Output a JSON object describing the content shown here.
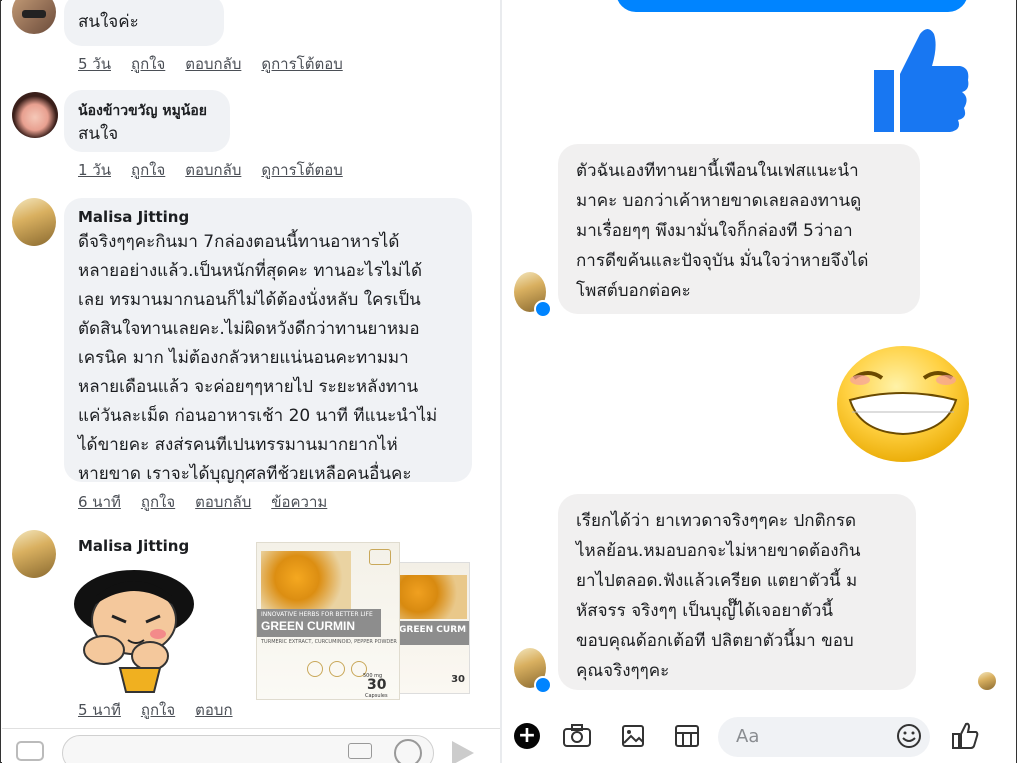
{
  "comments": [
    {
      "name": "",
      "text": "สนใจค่ะ",
      "time": "5 วัน",
      "like": "ถูกใจ",
      "reply": "ตอบกลับ",
      "more": "ดูการโต้ตอบ"
    },
    {
      "name": "น้องข้าวขวัญ หมูน้อย",
      "text": "สนใจ",
      "time": "1 วัน",
      "like": "ถูกใจ",
      "reply": "ตอบกลับ",
      "more": "ดูการโต้ตอบ"
    },
    {
      "name": "Malisa Jitting",
      "lines": [
        "ดีจริงๆๆคะกินมา 7กล่องตอนนี้ทานอาหารได้",
        "หลายอย่างแล้ว.เป็นหนักที่สุดคะ ทานอะไรไม่ได้",
        "เลย ทรมานมากนอนก็ไม่ได้ต้องนั่งหลับ ใครเป็น",
        "ตัดสินใจทานเลยคะ.ไม่ผิดหวังดีกว่าทานยาหมอ",
        "เครนิค มาก ไม่ต้องกลัวหายแน่นอนคะทามมา",
        "หลายเดือนแล้ว จะค่อยๆๆหายไป ระยะหลังทาน",
        "แค่วันละเม็ด ก่อนอาหารเช้า 20 นาที ทีแนะนำไม่",
        "ได้ขายคะ สงส่รคนทีเปนทรรมานมากยากไห่",
        "หายขาด เราจะได้บุญกุศลทีช้วยเหลือคนอื่นคะ"
      ],
      "time": "6 นาที",
      "like": "ถูกใจ",
      "reply": "ตอบกลับ",
      "more": "ข้อความ"
    },
    {
      "name": "Malisa Jitting",
      "time": "5 นาที",
      "like": "ถูกใจ",
      "reply": "ตอบก"
    }
  ],
  "product": {
    "tagline": "INNOVATIVE HERBS FOR BETTER LIFE",
    "brand": "GREEN CURMIN",
    "sub": "TURMERIC EXTRACT, CURCUMINOID, PEPPER POWDER",
    "count": "30",
    "count_unit": "Capsules",
    "dose": "500 mg"
  },
  "messages": [
    {
      "lines": [
        "ตัวฉันเองทีทานยานี้เพือนในเฟสแนะนำ",
        "มาคะ บอกว่าเค้าหายขาดเลยลองทานดู",
        "มาเรื่อยๆๆ พึงมามั่นใจก็กล่องที 5ว่าอา",
        "การดีขค้นและปัจจุบัน มั่นใจว่าหายจึงได่",
        "โพสต์บอกต่อคะ"
      ]
    },
    {
      "lines": [
        "เรียกได้ว่า ยาเทวดาจริงๆๆคะ ปกติกรด",
        "ไหลย้อน.หมอบอกจะไม่หายขาดต้องกิน",
        "ยาไปตลอด.ฟังแล้วเครียด แตยาตัวนี้ ม",
        "หัสจรร จริงๆๆ เป็นบุญ๊๊ได้เจอยาตัวนี้",
        "ขอบคุณด้อกเต้อที ปลิตยาตัวนี้มา ขอบ",
        "คุณจริงๆๆคะ"
      ]
    }
  ],
  "composer": {
    "placeholder": "Aa"
  },
  "colors": {
    "messenger_blue": "#0084ff",
    "bubble": "#f0f2f5"
  }
}
